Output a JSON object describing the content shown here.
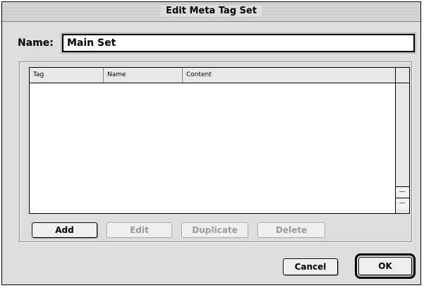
{
  "dialog": {
    "title": "Edit Meta Tag Set",
    "name_label": "Name:",
    "name_value": "Main Set"
  },
  "table": {
    "columns": [
      "Tag",
      "Name",
      "Content"
    ],
    "rows": []
  },
  "buttons": {
    "add": "Add",
    "edit": "Edit",
    "duplicate": "Duplicate",
    "delete": "Delete",
    "cancel": "Cancel",
    "ok": "OK"
  },
  "colors": {
    "window_bg": "#dddddd",
    "disabled_text": "#9a9a9a"
  }
}
